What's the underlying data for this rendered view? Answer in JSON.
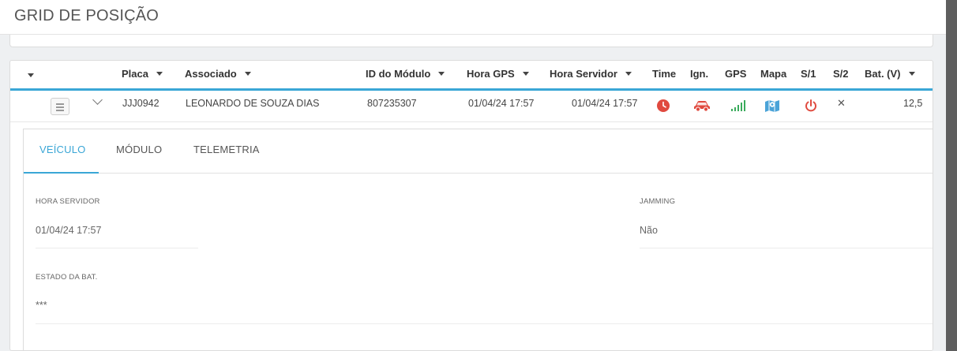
{
  "page": {
    "title": "GRID DE POSIÇÃO"
  },
  "grid": {
    "columns": {
      "placa": "Placa",
      "associado": "Associado",
      "id_modulo": "ID do Módulo",
      "hora_gps": "Hora GPS",
      "hora_servidor": "Hora Servidor",
      "time": "Time",
      "ign": "Ign.",
      "gps": "GPS",
      "mapa": "Mapa",
      "s1": "S/1",
      "s2": "S/2",
      "bat": "Bat. (V)"
    },
    "row": {
      "placa": "JJJ0942",
      "associado": "LEONARDO DE SOUZA DIAS",
      "id_modulo": "807235307",
      "hora_gps": "01/04/24 17:57",
      "hora_servidor": "01/04/24 17:57",
      "s2": "✕",
      "bat": "12,5",
      "icons": {
        "time": "clock-icon",
        "ign": "car-icon",
        "gps": "signal-bars-icon",
        "mapa": "map-icon",
        "s1": "power-icon"
      }
    },
    "colors": {
      "accent": "#3aa6d6",
      "alert_red": "#e04a3f",
      "signal_green": "#3aab5c",
      "map_blue": "#4aa3d8"
    }
  },
  "details": {
    "tabs": [
      "VEÍCULO",
      "MÓDULO",
      "TELEMETRIA"
    ],
    "active_tab": "VEÍCULO",
    "fields": {
      "hora_servidor": {
        "label": "HORA SERVIDOR",
        "value": "01/04/24 17:57"
      },
      "jamming": {
        "label": "JAMMING",
        "value": "Não"
      },
      "estado_bat": {
        "label": "ESTADO DA BAT.",
        "value": "***"
      }
    }
  }
}
